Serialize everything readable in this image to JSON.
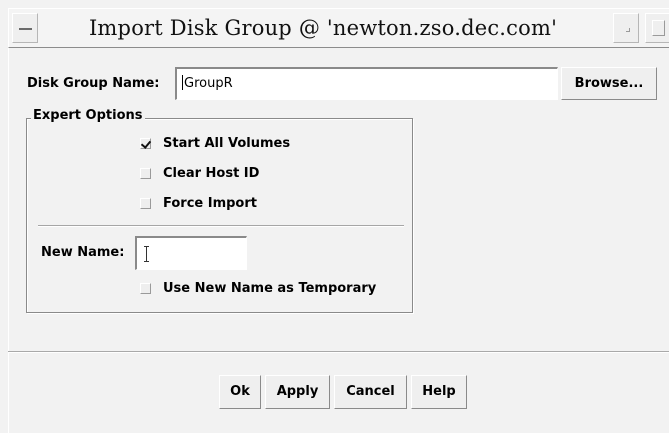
{
  "window": {
    "title": "Import Disk Group @ 'newton.zso.dec.com'"
  },
  "disk_group": {
    "label": "Disk Group Name:",
    "value": "GroupR",
    "browse_label": "Browse..."
  },
  "expert_options": {
    "legend": "Expert Options",
    "options": [
      {
        "label": "Start All Volumes",
        "checked": true
      },
      {
        "label": "Clear Host ID",
        "checked": false
      },
      {
        "label": "Force Import",
        "checked": false
      }
    ],
    "new_name": {
      "label": "New Name:",
      "value": ""
    },
    "use_temporary": {
      "label": "Use New Name as Temporary",
      "checked": false
    }
  },
  "buttons": {
    "ok": "Ok",
    "apply": "Apply",
    "cancel": "Cancel",
    "help": "Help"
  },
  "icons": {
    "window_menu": "window-menu-icon",
    "minimize": "minimize-icon",
    "maximize": "maximize-icon",
    "checkmark": "checkmark-icon",
    "text_cursor": "ibeam-cursor-icon"
  }
}
